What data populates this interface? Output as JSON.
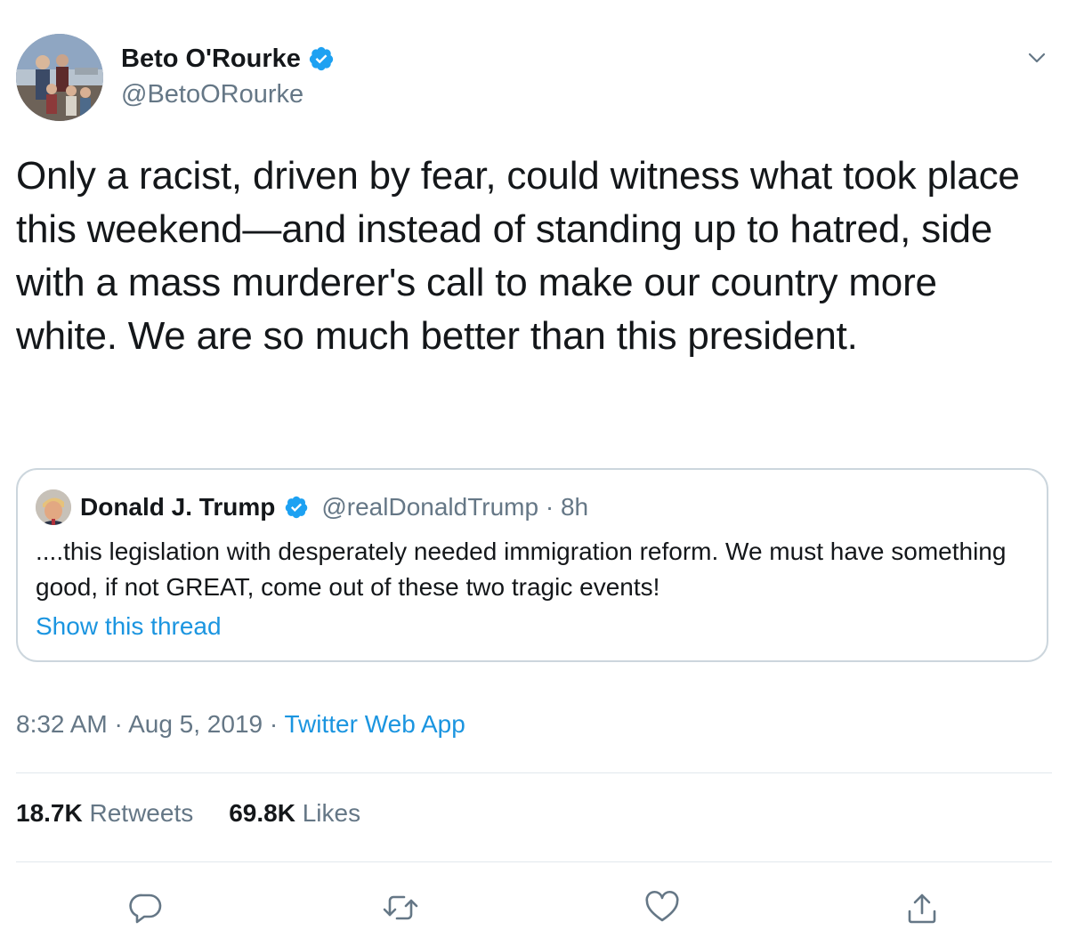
{
  "author": {
    "name": "Beto O'Rourke",
    "handle": "@BetoORourke",
    "verified": true
  },
  "tweet": {
    "text": "Only a racist, driven by fear, could witness what took place this weekend—and instead of standing up to hatred, side with a mass murderer's call to make our country more white. We are so much better than this president."
  },
  "quoted_tweet": {
    "name": "Donald J. Trump",
    "handle_time": "@realDonaldTrump · 8h",
    "verified": true,
    "text": "....this legislation with desperately needed immigration reform. We must have something good, if not GREAT, come out of these two tragic events!",
    "show_thread": "Show this thread"
  },
  "meta": {
    "time_date": "8:32 AM · Aug 5, 2019 · ",
    "source": "Twitter Web App"
  },
  "stats": {
    "retweets_count": "18.7K",
    "retweets_label": "Retweets",
    "likes_count": "69.8K",
    "likes_label": "Likes"
  },
  "icons": {
    "caret": "chevron-down-icon",
    "reply": "reply-icon",
    "retweet": "retweet-icon",
    "like": "heart-icon",
    "share": "share-icon",
    "verified": "verified-badge-icon"
  },
  "colors": {
    "accent": "#1b95e0",
    "verified": "#1da1f2",
    "secondary_text": "#657786",
    "border": "#ccd6dd",
    "icon": "#657786"
  }
}
